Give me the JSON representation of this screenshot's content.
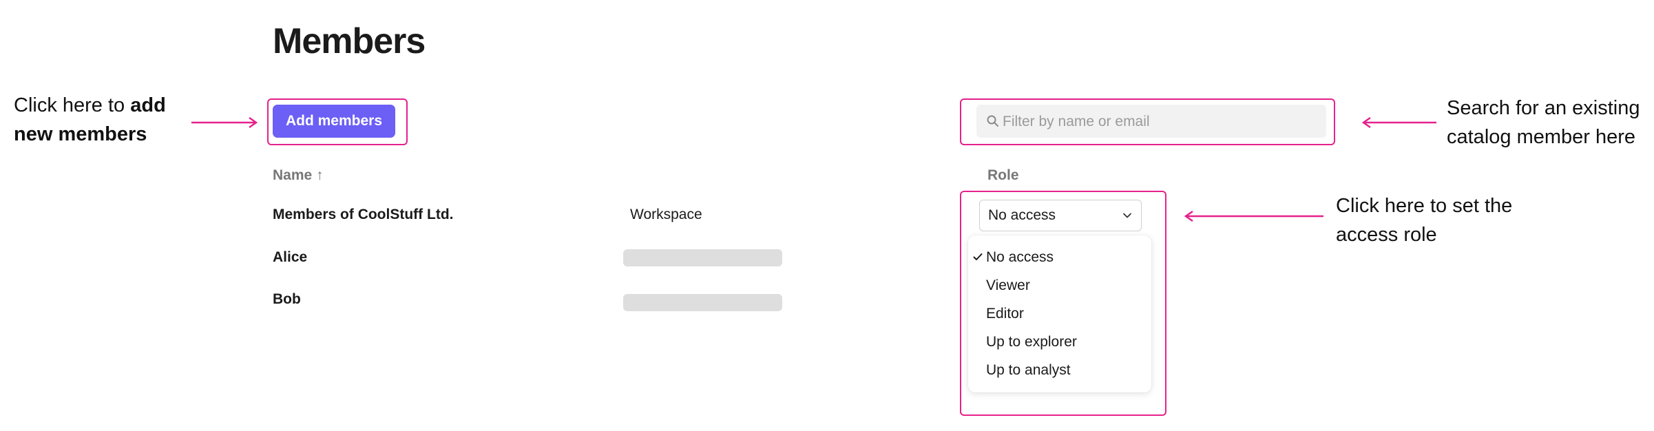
{
  "page": {
    "title": "Members"
  },
  "callouts": {
    "add": {
      "prefix": "Click here to ",
      "bold_1": "add",
      "bold_2": "new members"
    },
    "search": {
      "line1": "Search for an existing",
      "line2": "catalog member here"
    },
    "role": {
      "line1": "Click here to set the",
      "line2": "access role"
    }
  },
  "toolbar": {
    "add_label": "Add members",
    "search_placeholder": "Filter by name or email"
  },
  "table": {
    "headers": {
      "name": "Name ↑",
      "role": "Role"
    },
    "rows": [
      {
        "name": "Members of CoolStuff Ltd.",
        "type": "Workspace"
      },
      {
        "name": "Alice"
      },
      {
        "name": "Bob"
      }
    ]
  },
  "role_select": {
    "selected": "No access",
    "options": [
      "No access",
      "Viewer",
      "Editor",
      "Up to explorer",
      "Up to analyst"
    ]
  },
  "colors": {
    "accent": "#6b5ff5",
    "annotation": "#e5218b",
    "skeleton": "#dedede"
  },
  "icons": {
    "search": "search-icon",
    "chevron": "chevron-down-icon",
    "check": "check-icon"
  }
}
